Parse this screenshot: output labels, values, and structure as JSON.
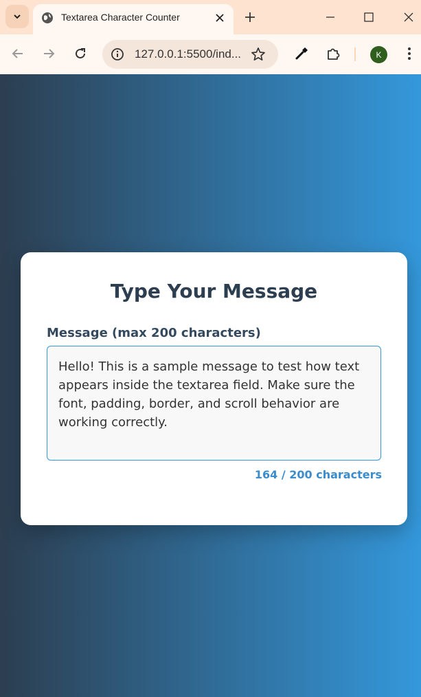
{
  "browser": {
    "tab_title": "Textarea Character Counter",
    "url": "127.0.0.1:5500/ind...",
    "profile_initial": "K",
    "icons": {
      "tab_search": "chevron-down-icon",
      "favicon": "globe-icon",
      "tab_close": "close-icon",
      "new_tab": "plus-icon",
      "minimize": "minimize-icon",
      "maximize": "maximize-icon",
      "close_window": "close-icon",
      "back": "arrow-left-icon",
      "forward": "arrow-right-icon",
      "reload": "reload-icon",
      "site_info": "info-icon",
      "bookmark": "star-icon",
      "eyedropper": "eyedropper-icon",
      "extensions": "puzzle-icon",
      "menu": "kebab-menu-icon"
    }
  },
  "page": {
    "title": "Type Your Message",
    "label": "Message (max 200 characters)",
    "message_value": "Hello! This is a sample message to test how text appears inside the textarea field. Make sure the font, padding, border, and scroll behavior are working correctly.",
    "counter": "164 / 200 characters"
  },
  "colors": {
    "gradient_start": "#2c3e50",
    "gradient_end": "#3498db",
    "title": "#2c3e50",
    "accent": "#3498db",
    "counter": "#3a8ccd"
  }
}
